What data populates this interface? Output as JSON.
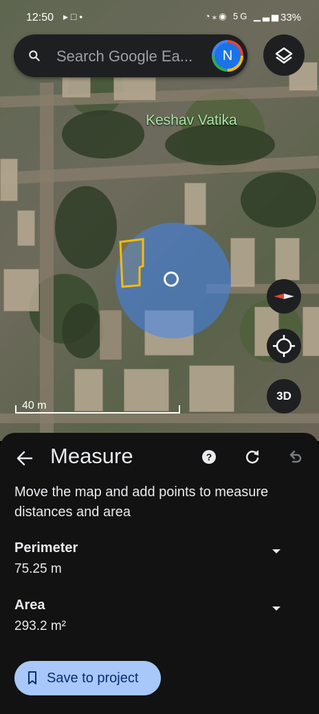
{
  "status_bar": {
    "time": "12:50",
    "battery": "33%",
    "network_label": "5G"
  },
  "search": {
    "placeholder": "Search Google Ea...",
    "avatar_initial": "N"
  },
  "map": {
    "place_label": "Keshav Vatika",
    "scale_label": "40 m",
    "view_toggle_label": "3D",
    "measure_circle_color": "#4285f4",
    "shape_outline_color": "#fbbc04"
  },
  "sheet": {
    "title": "Measure",
    "description": "Move the map and add points to measure distances and area",
    "perimeter": {
      "label": "Perimeter",
      "value": "75.25 m"
    },
    "area": {
      "label": "Area",
      "value": "293.2 m²"
    },
    "save_button_label": "Save to project"
  },
  "icons": [
    "search-icon",
    "layers-icon",
    "compass-icon",
    "my-location-icon",
    "back-arrow-icon",
    "help-icon",
    "redo-icon",
    "undo-icon",
    "chevron-down-icon",
    "bookmark-icon"
  ]
}
